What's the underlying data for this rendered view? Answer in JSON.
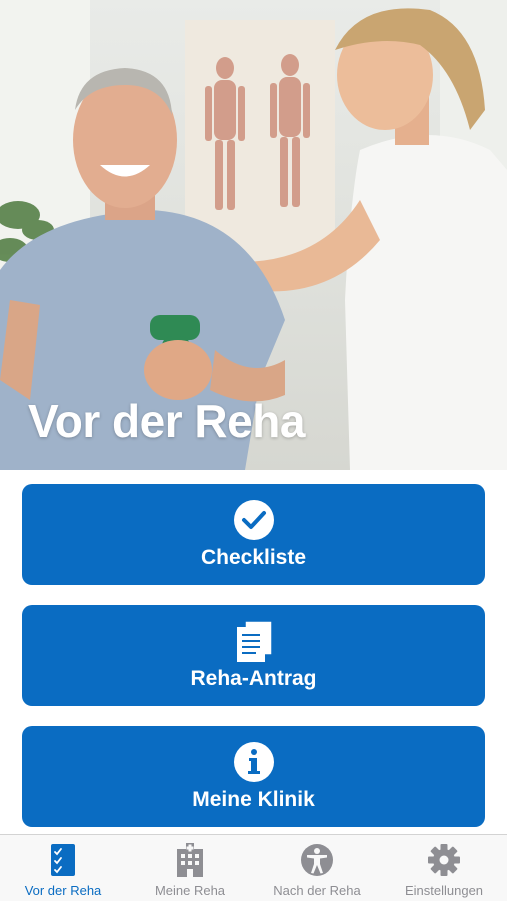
{
  "hero": {
    "title": "Vor der Reha"
  },
  "menu": [
    {
      "label": "Checkliste",
      "icon": "checkmark-circle-icon"
    },
    {
      "label": "Reha-Antrag",
      "icon": "documents-icon"
    },
    {
      "label": "Meine Klinik",
      "icon": "info-circle-icon"
    }
  ],
  "tabs": [
    {
      "label": "Vor der Reha",
      "icon": "checklist-icon",
      "active": true
    },
    {
      "label": "Meine Reha",
      "icon": "hospital-icon",
      "active": false
    },
    {
      "label": "Nach der Reha",
      "icon": "accessibility-icon",
      "active": false
    },
    {
      "label": "Einstellungen",
      "icon": "gear-icon",
      "active": false
    }
  ],
  "colors": {
    "accent": "#0a6cc2",
    "tab_inactive": "#8e8e93",
    "tabbar_bg": "#f8f8f8"
  }
}
